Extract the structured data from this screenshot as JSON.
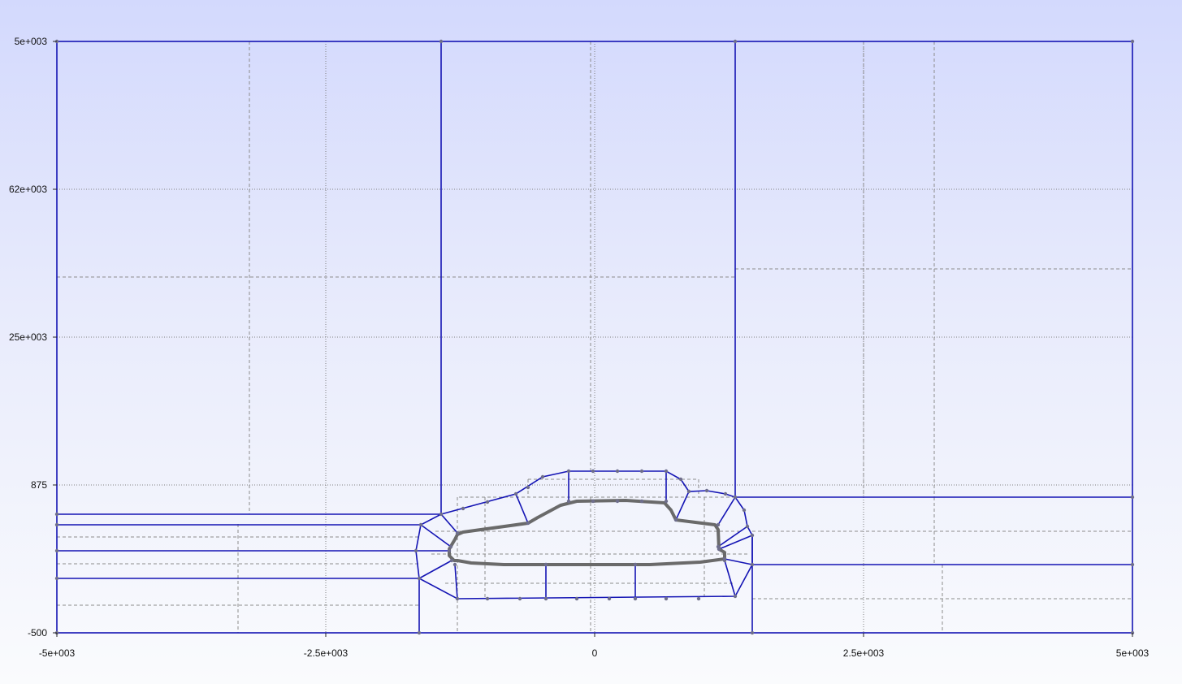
{
  "viewer": {
    "x_axis": {
      "range": [
        -5000,
        5000
      ],
      "tick_labels": [
        "-5e+003",
        "-2.5e+003",
        "0",
        "2.5e+003",
        "5e+003"
      ]
    },
    "y_axis": {
      "range": [
        -500,
        5000
      ],
      "tick_labels": [
        "-500",
        "875",
        "25e+003",
        "62e+003",
        "5e+003"
      ]
    },
    "colors": {
      "block_edge": "#1414b4",
      "vertex": "#6e6e8c",
      "geometry": "#6a6a6a",
      "grid_major": "#8a8a8a",
      "grid_minor": "#8a8a8a"
    },
    "icons": [
      "vertex-icon"
    ]
  }
}
